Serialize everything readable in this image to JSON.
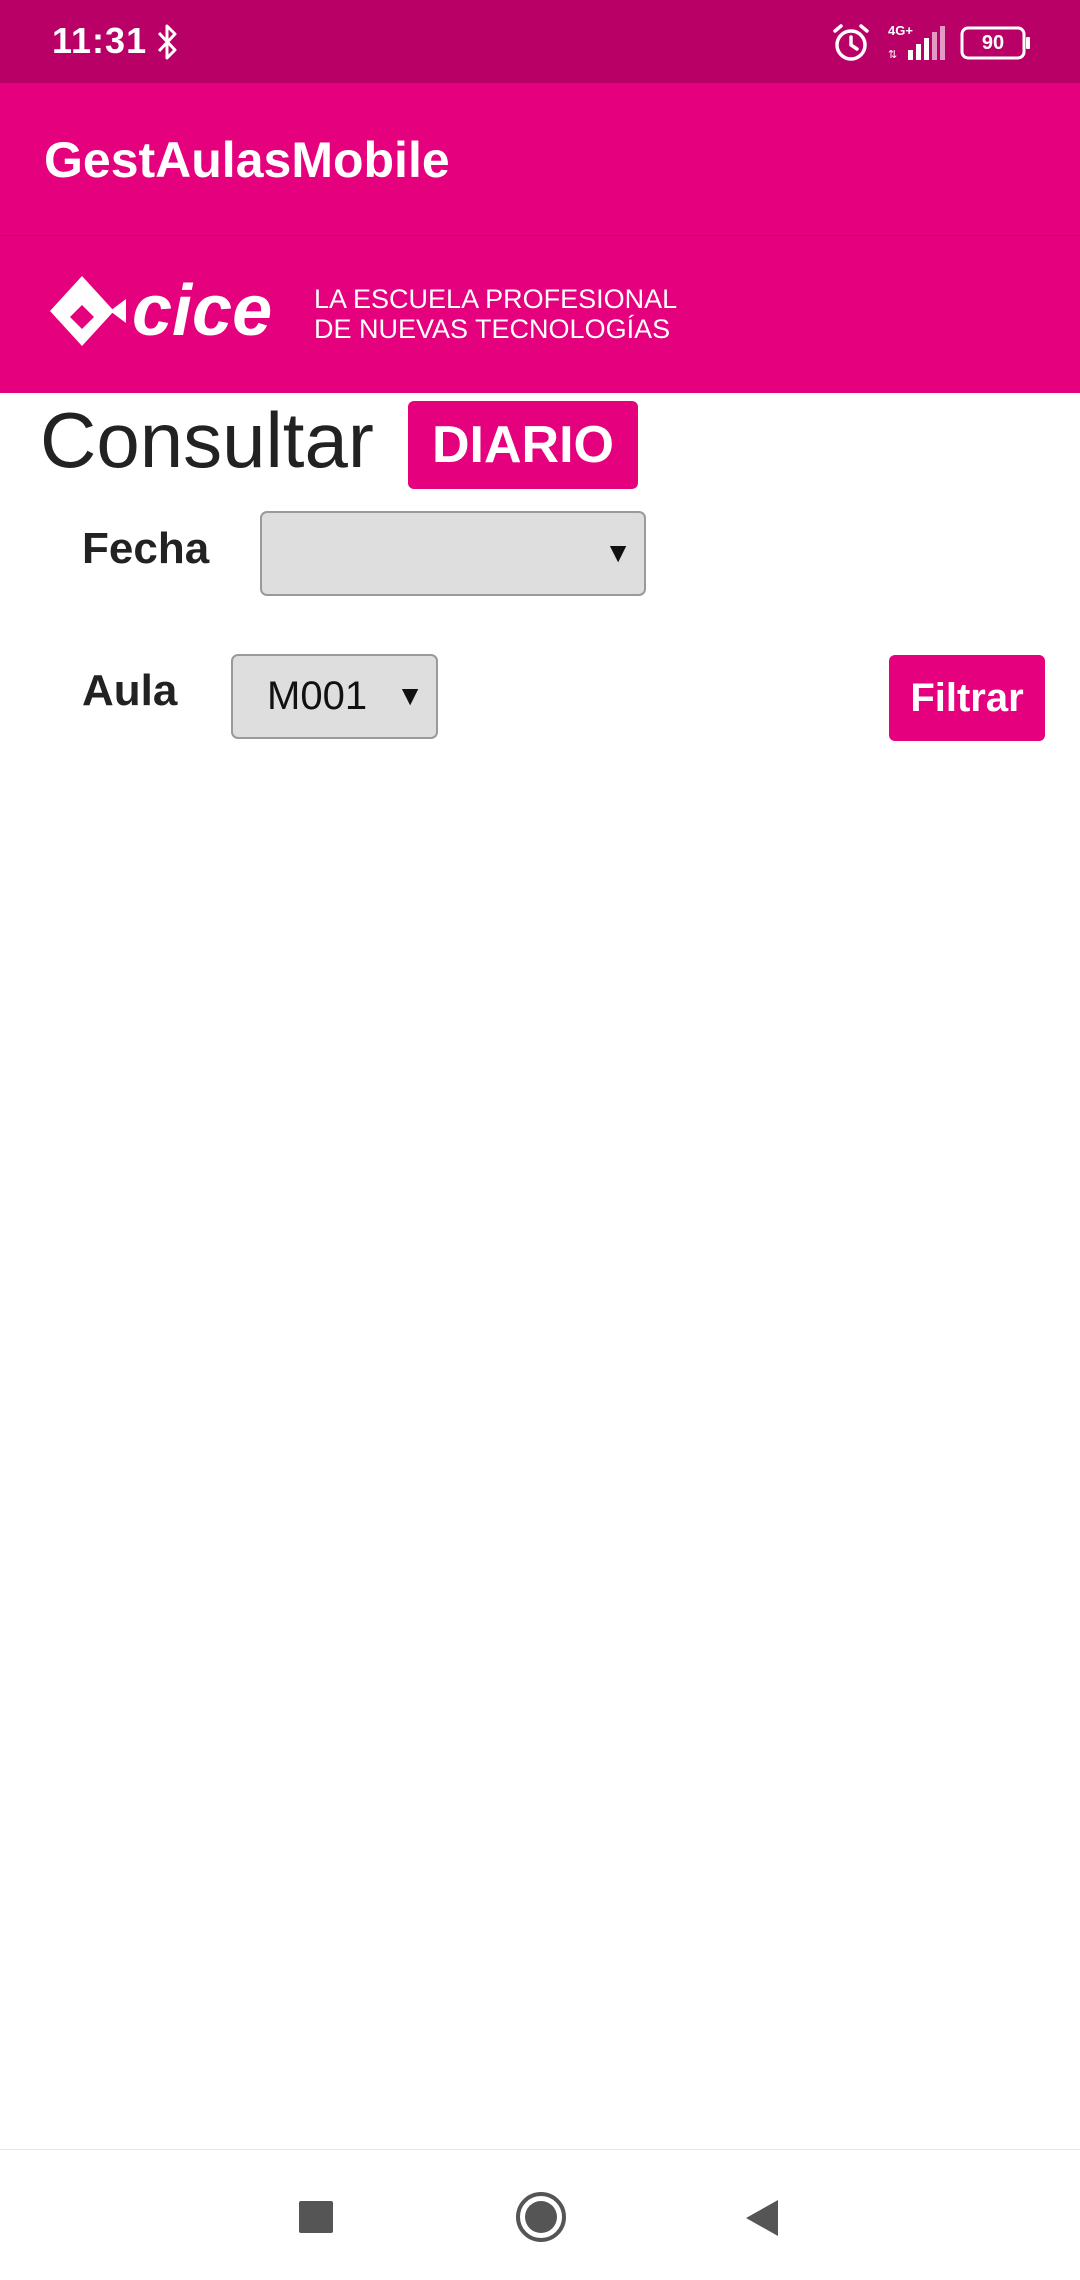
{
  "status_bar": {
    "time": "11:31",
    "battery": "90",
    "network": "4G+",
    "icons": [
      "bluetooth-icon",
      "alarm-icon",
      "signal-icon",
      "battery-icon"
    ]
  },
  "app_bar": {
    "title": "GestAulasMobile"
  },
  "logo": {
    "brand": "cice",
    "tagline_line1": "LA ESCUELA PROFESIONAL",
    "tagline_line2": "DE NUEVAS TECNOLOGÍAS"
  },
  "page": {
    "heading": "Consultar",
    "badge": "DIARIO"
  },
  "form": {
    "fecha_label": "Fecha",
    "fecha_value": "",
    "aula_label": "Aula",
    "aula_value": "M001",
    "filter_label": "Filtrar"
  },
  "nav": {
    "icons": [
      "recents-icon",
      "home-icon",
      "back-icon"
    ]
  },
  "colors": {
    "status_bar": "#b80067",
    "brand": "#e5007e",
    "select_bg": "#dedede"
  }
}
